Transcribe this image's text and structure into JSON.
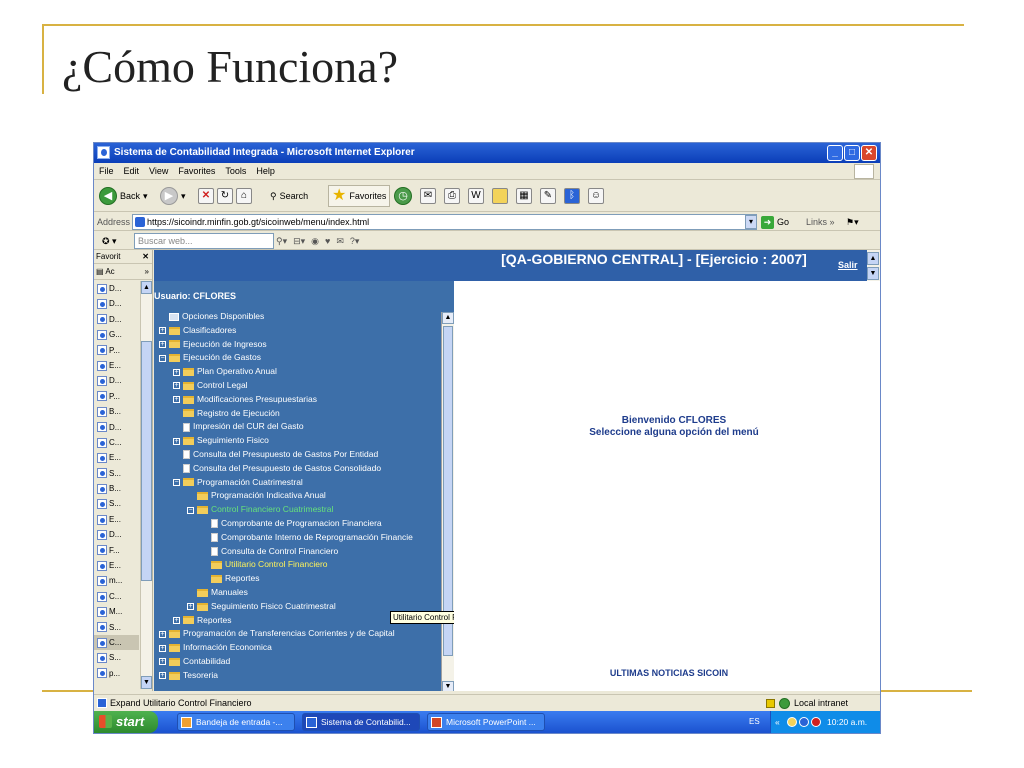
{
  "slide": {
    "title": "¿Cómo Funciona?"
  },
  "colors": {
    "accent_gold": "#d8b243",
    "menu_blue": "#3d6fa9",
    "header_blue": "#2f60a8",
    "link_green": "#66e27a",
    "link_yellow": "#fff35a"
  },
  "browser": {
    "title": "Sistema de Contabilidad Integrada - Microsoft Internet Explorer",
    "menu": [
      "File",
      "Edit",
      "View",
      "Favorites",
      "Tools",
      "Help"
    ],
    "toolbar": {
      "back_label": "Back",
      "search_label": "Search",
      "favorites_label": "Favorites"
    },
    "address": {
      "label": "Address",
      "url": "https://sicoindr.minfin.gob.gt/sicoinweb/menu/index.html",
      "go_label": "Go",
      "links_label": "Links"
    },
    "search_placeholder": "Buscar web...",
    "favorites_pane": {
      "title": "Favorit",
      "sub": "Ac",
      "items": [
        "D...",
        "D...",
        "D...",
        "G...",
        "P...",
        "E...",
        "D...",
        "P...",
        "B...",
        "D...",
        "C...",
        "E...",
        "S...",
        "B...",
        "S...",
        "E...",
        "D...",
        "F...",
        "E...",
        "m...",
        "C...",
        "M...",
        "S...",
        "C...",
        "S...",
        "p..."
      ]
    },
    "page": {
      "header_title": "[QA-GOBIERNO CENTRAL] - [Ejercicio : 2007]",
      "salir": "Salir",
      "usuario": "Usuario: CFLORES",
      "welcome_line1": "Bienvenido CFLORES",
      "welcome_line2": "Seleccione alguna opción del menú",
      "noticias": "ULTIMAS NOTICIAS SICOIN",
      "tooltip": "Utilitario Control Financiero",
      "tree": [
        {
          "label": "Opciones Disponibles",
          "depth": 0,
          "toggle": "",
          "icon": "pc"
        },
        {
          "label": "Clasificadores",
          "depth": 0,
          "toggle": "+",
          "icon": "folder"
        },
        {
          "label": "Ejecución de Ingresos",
          "depth": 0,
          "toggle": "+",
          "icon": "folder"
        },
        {
          "label": "Ejecución de Gastos",
          "depth": 0,
          "toggle": "-",
          "icon": "folder-open"
        },
        {
          "label": "Plan Operativo Anual",
          "depth": 1,
          "toggle": "+",
          "icon": "folder"
        },
        {
          "label": "Control Legal",
          "depth": 1,
          "toggle": "+",
          "icon": "folder"
        },
        {
          "label": "Modificaciones Presupuestarias",
          "depth": 1,
          "toggle": "+",
          "icon": "folder"
        },
        {
          "label": "Registro de Ejecución",
          "depth": 1,
          "toggle": "",
          "icon": "folder"
        },
        {
          "label": "Impresión del CUR del Gasto",
          "depth": 1,
          "toggle": "",
          "icon": "doc"
        },
        {
          "label": "Seguimiento Fisico",
          "depth": 1,
          "toggle": "+",
          "icon": "folder"
        },
        {
          "label": "Consulta del Presupuesto de Gastos Por Entidad",
          "depth": 1,
          "toggle": "",
          "icon": "doc"
        },
        {
          "label": "Consulta del Presupuesto de Gastos Consolidado",
          "depth": 1,
          "toggle": "",
          "icon": "doc"
        },
        {
          "label": "Programación Cuatrimestral",
          "depth": 1,
          "toggle": "-",
          "icon": "folder-open"
        },
        {
          "label": "Programación Indicativa Anual",
          "depth": 2,
          "toggle": "",
          "icon": "folder"
        },
        {
          "label": "Control Financiero Cuatrimestral",
          "depth": 2,
          "toggle": "-",
          "icon": "folder-open",
          "style": "green"
        },
        {
          "label": "Comprobante de Programacion Financiera",
          "depth": 3,
          "toggle": "",
          "icon": "doc"
        },
        {
          "label": "Comprobante Interno de Reprogramación Financie",
          "depth": 3,
          "toggle": "",
          "icon": "doc"
        },
        {
          "label": "Consulta de Control Financiero",
          "depth": 3,
          "toggle": "",
          "icon": "doc"
        },
        {
          "label": "Utilitario Control Financiero",
          "depth": 3,
          "toggle": "",
          "icon": "folder",
          "style": "yellow"
        },
        {
          "label": "Reportes",
          "depth": 3,
          "toggle": "",
          "icon": "folder"
        },
        {
          "label": "Manuales",
          "depth": 2,
          "toggle": "",
          "icon": "folder"
        },
        {
          "label": "Seguimiento Fisico Cuatrimestral",
          "depth": 2,
          "toggle": "+",
          "icon": "folder"
        },
        {
          "label": "Reportes",
          "depth": 1,
          "toggle": "+",
          "icon": "folder"
        },
        {
          "label": "Programación de Transferencias Corrientes y de Capital",
          "depth": 0,
          "toggle": "+",
          "icon": "folder"
        },
        {
          "label": "Información Economica",
          "depth": 0,
          "toggle": "+",
          "icon": "folder"
        },
        {
          "label": "Contabilidad",
          "depth": 0,
          "toggle": "+",
          "icon": "folder"
        },
        {
          "label": "Tesoreria",
          "depth": 0,
          "toggle": "+",
          "icon": "folder"
        }
      ]
    },
    "status": {
      "text": "Expand Utilitario Control Financiero",
      "zone": "Local intranet"
    },
    "taskbar": {
      "start": "start",
      "tasks": [
        "Bandeja de entrada -...",
        "Sistema de Contabilid...",
        "Microsoft PowerPoint ..."
      ],
      "lang": "ES",
      "clock": "10:20 a.m."
    }
  }
}
